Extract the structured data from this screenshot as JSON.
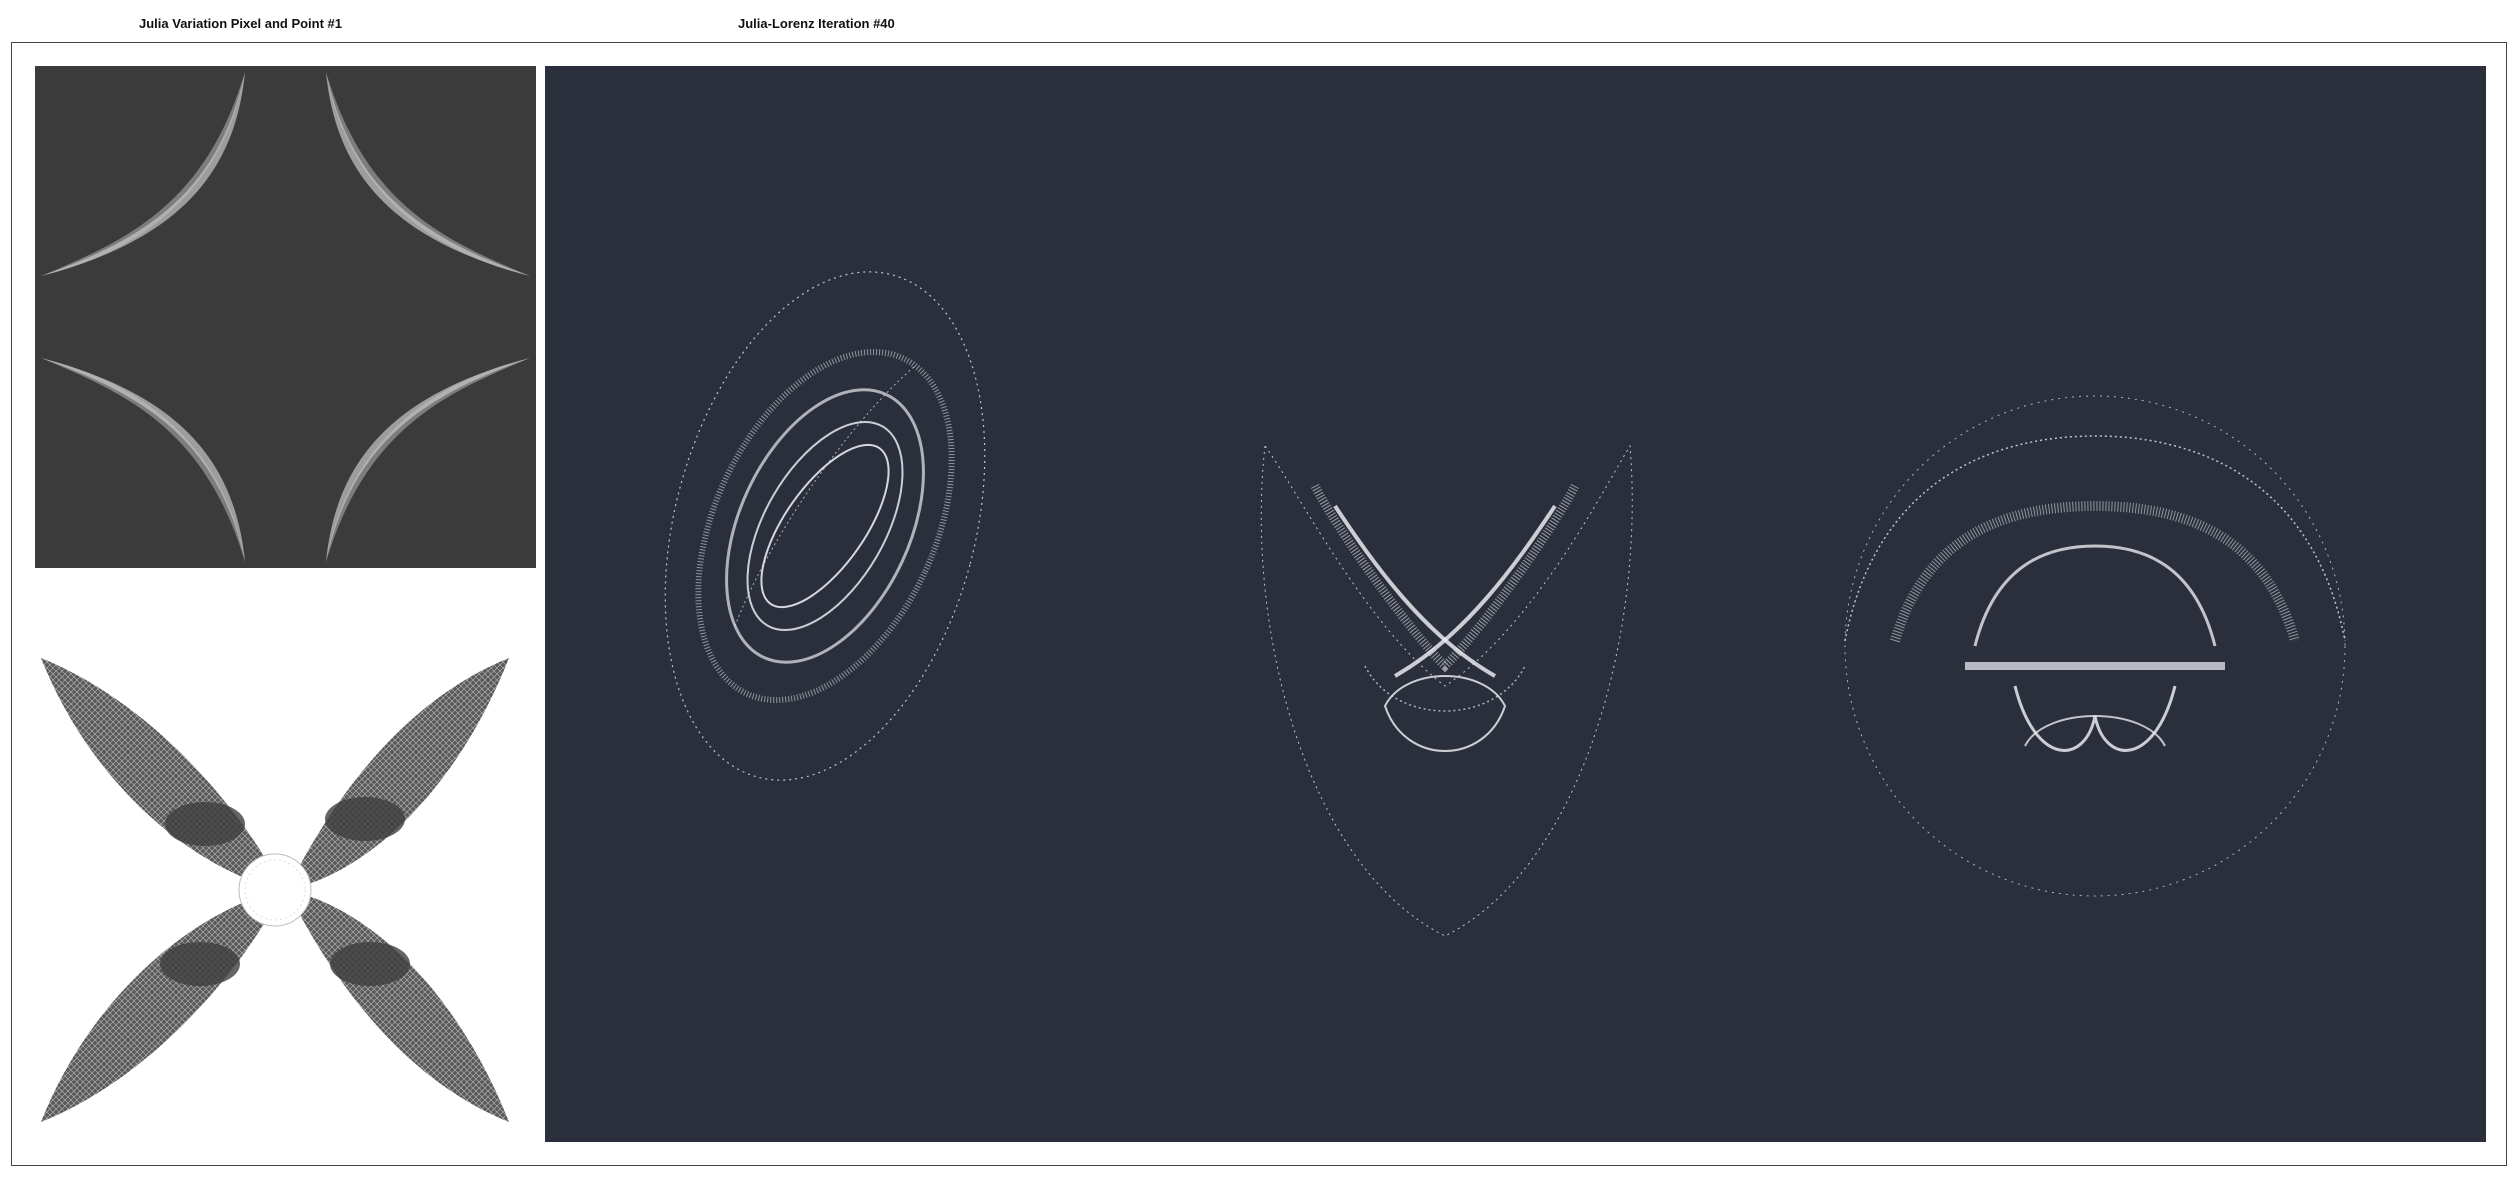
{
  "titles": {
    "left": "Julia Variation Pixel and Point #1",
    "right": "Julia-Lorenz Iteration #40"
  },
  "colors": {
    "pixel_bg": "#3b3b3b",
    "lorenz_bg": "#2a2f3b",
    "point_bg": "#ffffff",
    "dots": "#e8eaef"
  },
  "panels": {
    "pixel": {
      "name": "julia-pixel-render"
    },
    "point": {
      "name": "julia-point-render"
    },
    "lorenz": {
      "name": "julia-lorenz-render",
      "attractor_count": 3
    }
  }
}
